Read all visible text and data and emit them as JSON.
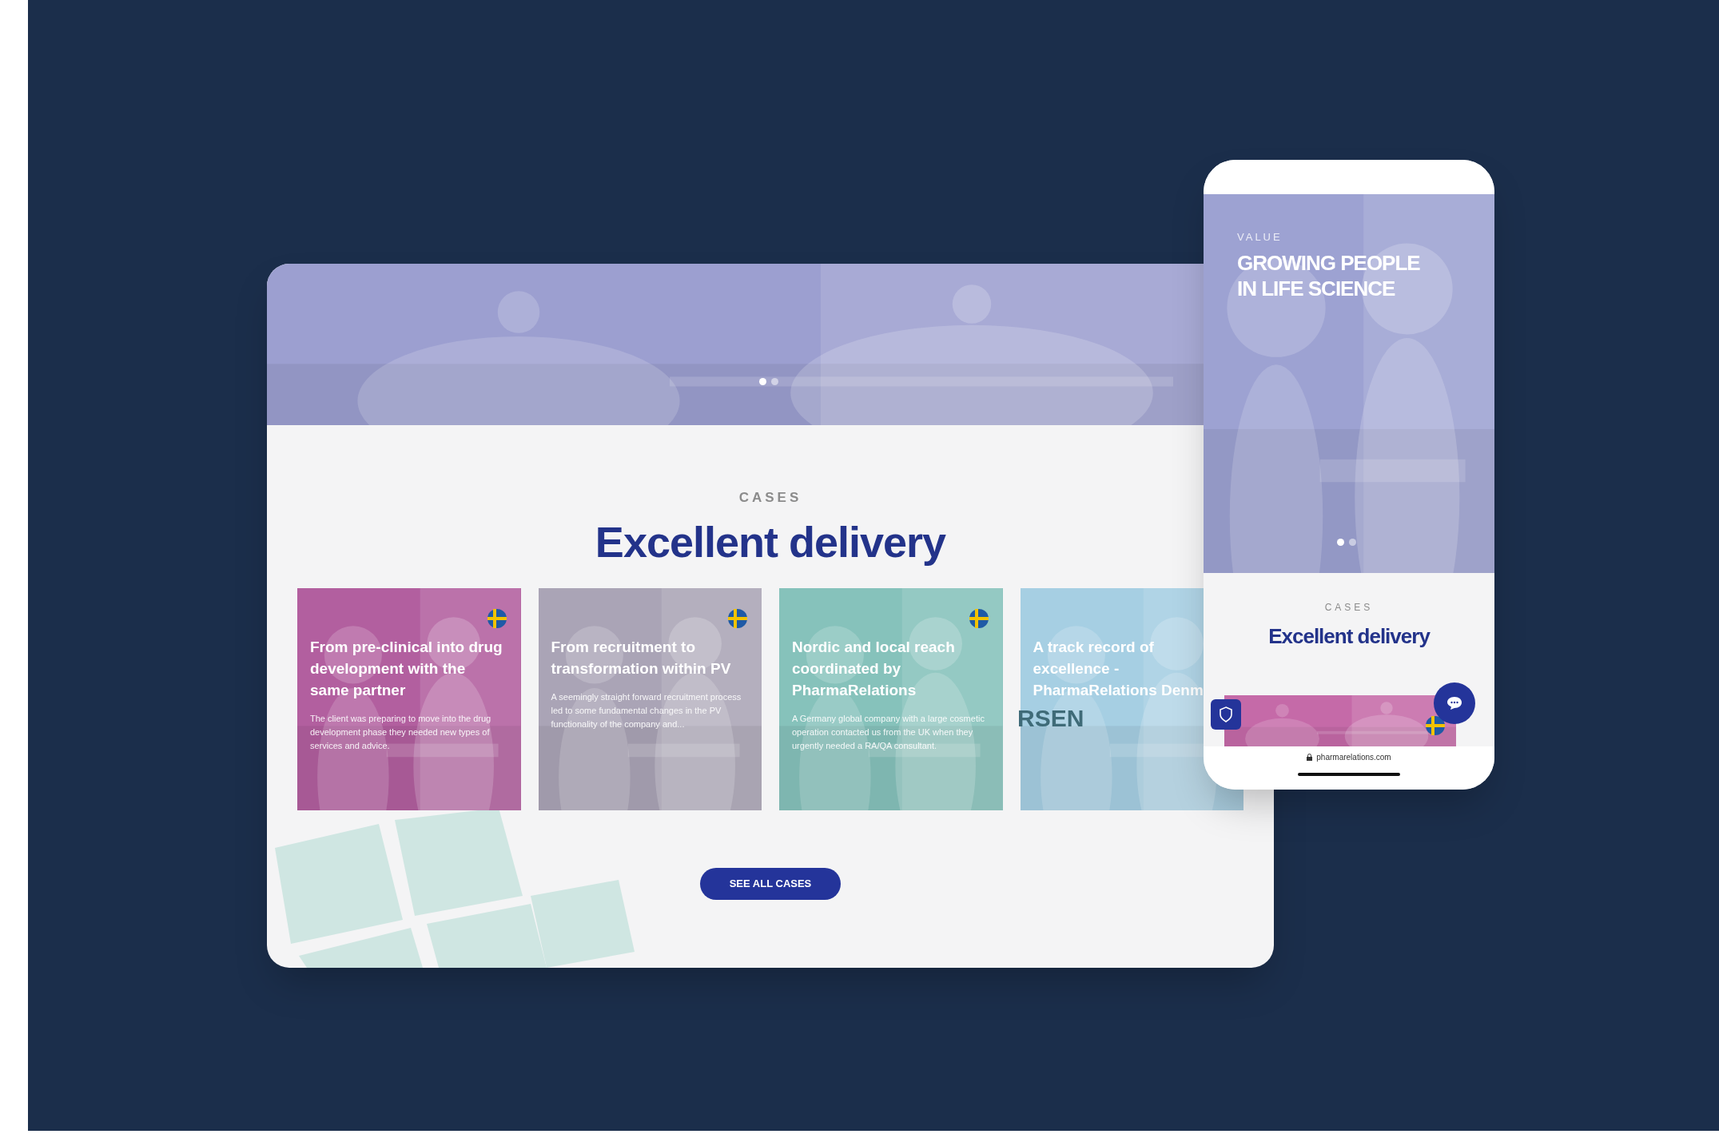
{
  "desktop": {
    "hero": {
      "kind": "picture",
      "dots": [
        {
          "selected": true
        },
        {
          "selected": false
        }
      ]
    },
    "eyebrow": "CASES",
    "title": "Excellent delivery",
    "cases": [
      {
        "title": "From pre-clinical into drug development with the same partner",
        "description": "The client was preparing to move into the drug development phase they needed new types of services and advice.",
        "color": "#b25f9f",
        "flag": true
      },
      {
        "title": "From recruitment to transformation within PV",
        "description": "A seemingly straight forward recruitment process led to some fundamental changes in the PV functionality of the company and...",
        "color": "#aaa4b6",
        "flag": true
      },
      {
        "title": "Nordic and local reach coordinated by PharmaRelations",
        "description": "A Germany global company with a large cosmetic operation contacted us from the UK when they urgently needed a RA/QA consultant.",
        "color": "#86c2bb",
        "flag": true
      },
      {
        "title": "A track record of excellence - PharmaRelations Denm",
        "color": "#a6cfe3",
        "flag": false
      }
    ],
    "overlay_text": "RSEN",
    "button": "SEE ALL CASES"
  },
  "mobile": {
    "hero": {
      "kind": "picture",
      "eyebrow": "VALUE",
      "title": "GROWING PEOPLE IN LIFE SCIENCE",
      "dots": [
        {
          "selected": true
        },
        {
          "selected": false
        }
      ]
    },
    "eyebrow": "CASES",
    "title": "Excellent delivery",
    "url": "pharmarelations.com"
  }
}
